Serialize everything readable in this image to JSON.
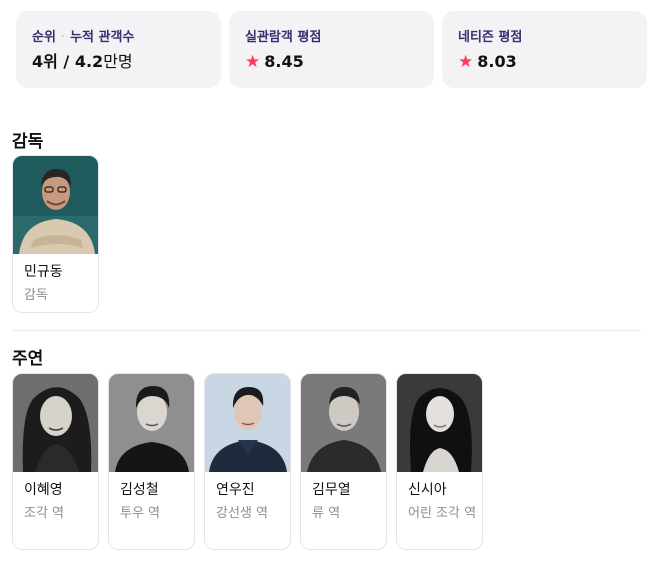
{
  "stats": [
    {
      "label_a": "순위",
      "label_b": "누적 관객수",
      "value_a": "4위",
      "value_sep": " / ",
      "value_b": "4.2",
      "value_b_unit": "만명"
    },
    {
      "label": "실관람객 평점",
      "value": "8.45",
      "icon": "star-icon"
    },
    {
      "label": "네티즌 평점",
      "value": "8.03",
      "icon": "star-icon"
    }
  ],
  "director_section": {
    "title": "감독",
    "people": [
      {
        "name": "민규동",
        "role": "감독"
      }
    ]
  },
  "cast_section": {
    "title": "주연",
    "people": [
      {
        "name": "이혜영",
        "role": "조각 역"
      },
      {
        "name": "김성철",
        "role": "투우 역"
      },
      {
        "name": "연우진",
        "role": "강선생 역"
      },
      {
        "name": "김무열",
        "role": "류 역"
      },
      {
        "name": "신시아",
        "role": "어린 조각 역"
      }
    ]
  },
  "colors": {
    "accent_star": "#ff3b57",
    "label_purple": "#3c2a6e",
    "card_bg": "#f3f3f6"
  }
}
